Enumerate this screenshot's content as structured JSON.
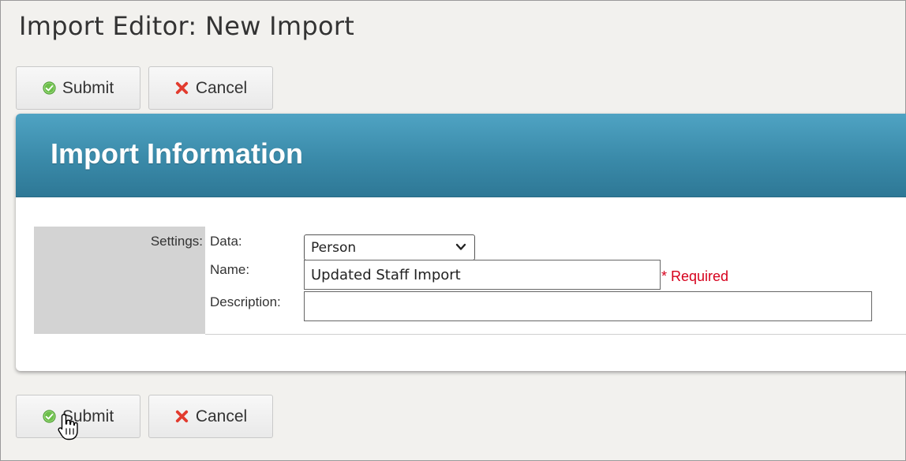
{
  "page": {
    "title": "Import Editor: New Import"
  },
  "toolbar": {
    "submit_label": "Submit",
    "cancel_label": "Cancel"
  },
  "panel": {
    "title": "Import Information",
    "header_color": "#3a8aa9"
  },
  "form": {
    "settings_label": "Settings:",
    "data_label": "Data:",
    "data_value": "Person",
    "name_label": "Name:",
    "name_value": "Updated Staff Import",
    "required_text": "* Required",
    "description_label": "Description:",
    "description_value": ""
  },
  "icons": {
    "submit": "check-circle-icon",
    "cancel": "x-icon",
    "select": "chevron-down-icon",
    "pointer": "hand-cursor-icon"
  },
  "colors": {
    "required": "#d6001c",
    "submit_icon": "#5cb85c",
    "cancel_icon": "#e53935"
  }
}
